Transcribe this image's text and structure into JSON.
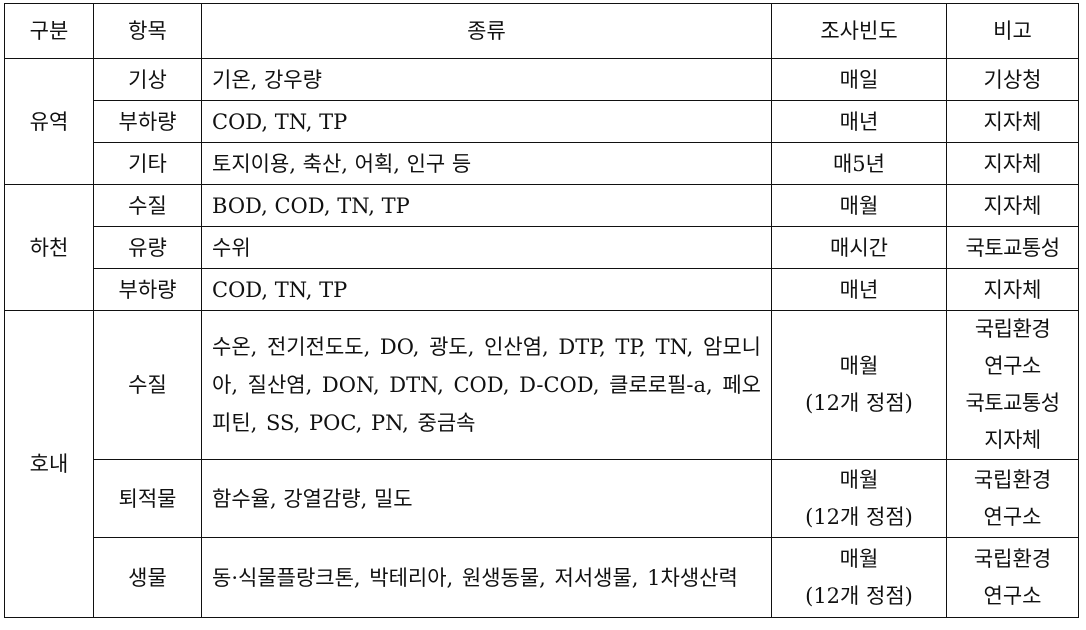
{
  "table": {
    "headers": [
      "구분",
      "항목",
      "종류",
      "조사빈도",
      "비고"
    ],
    "groups": [
      {
        "category": "유역",
        "rows": [
          {
            "item": "기상",
            "types": "기온, 강우량",
            "frequency": "매일",
            "note": "기상청"
          },
          {
            "item": "부하량",
            "types": "COD, TN, TP",
            "frequency": "매년",
            "note": "지자체"
          },
          {
            "item": "기타",
            "types": "토지이용, 축산, 어획, 인구 등",
            "frequency": "매5년",
            "note": "지자체"
          }
        ]
      },
      {
        "category": "하천",
        "rows": [
          {
            "item": "수질",
            "types": "BOD, COD, TN, TP",
            "frequency": "매월",
            "note": "지자체"
          },
          {
            "item": "유량",
            "types": "수위",
            "frequency": "매시간",
            "note": "국토교통성"
          },
          {
            "item": "부하량",
            "types": "COD, TN, TP",
            "frequency": "매년",
            "note": "지자체"
          }
        ]
      },
      {
        "category": "호내",
        "rows": [
          {
            "item": "수질",
            "types": "수온, 전기전도도, DO, 광도, 인산염, DTP, TP, TN, 암모니아, 질산염, DON, DTN, COD, D-COD, 클로로필-a, 페오피틴, SS, POC, PN, 중금속",
            "frequency_lines": [
              "매월",
              "(12개 정점)"
            ],
            "note_lines": [
              "국립환경",
              "연구소",
              "국토교통성",
              "지자체"
            ]
          },
          {
            "item": "퇴적물",
            "types": "함수율, 강열감량, 밀도",
            "frequency_lines": [
              "매월",
              "(12개 정점)"
            ],
            "note_lines": [
              "국립환경",
              "연구소"
            ]
          },
          {
            "item": "생물",
            "types": "동·식물플랑크톤, 박테리아, 원생동물, 저서생물, 1차생산력",
            "frequency_lines": [
              "매월",
              "(12개 정점)"
            ],
            "note_lines": [
              "국립환경",
              "연구소"
            ]
          }
        ]
      }
    ]
  }
}
